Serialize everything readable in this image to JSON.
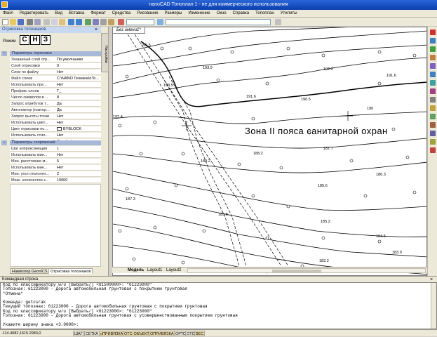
{
  "window": {
    "title": "nanoCAD Топоплан 1 - не для коммерческого использования"
  },
  "menu": [
    "Файл",
    "Редактировать",
    "Вид",
    "Вставка",
    "Формат",
    "Средства",
    "Рисование",
    "Размеры",
    "Изменение",
    "Окно",
    "Справка",
    "Топоплан",
    "Утилиты"
  ],
  "sidebar": {
    "title": "Отрисовка топознаков",
    "vtab": "Настройки",
    "mode_label": "Режим",
    "mode_buttons": [
      "С",
      "Н",
      "З"
    ],
    "section1": {
      "header": "Параметры отрисовки",
      "rows": [
        {
          "name": "Указанный слой отр...",
          "value": "По умолчанию"
        },
        {
          "name": "Слой отрисовки",
          "value": "0"
        },
        {
          "name": "Слои по файлу",
          "value": "Нет"
        },
        {
          "name": "Файл слоев",
          "value": "C:\\NANO Геоника\\nTo..."
        },
        {
          "name": "Использовать пре...",
          "value": "Нет"
        },
        {
          "name": "Префикс слоев",
          "value": "T_"
        },
        {
          "name": "Число символов в ...",
          "value": "8"
        },
        {
          "name": "Запрос атрибутов т...",
          "value": "Да"
        },
        {
          "name": "Автоповтор (повтор...",
          "value": "Да"
        },
        {
          "name": "Запрос высоты точки",
          "value": "Нет"
        },
        {
          "name": "Использовать цвет...",
          "value": "Нет"
        },
        {
          "name": "Цвет отрисовки по ...",
          "value": "BYBLOCK"
        },
        {
          "name": "Использовать стил...",
          "value": "Нет"
        },
        {
          "name": "Стиль текста и ад...",
          "value": "Standard"
        }
      ]
    },
    "section2": {
      "header": "Параметры сопряжений",
      "rows": [
        {
          "name": "Шаг аппроксимации",
          "value": "1"
        },
        {
          "name": "Использовать мин...",
          "value": "Нет"
        },
        {
          "name": "Мин. расстояние м...",
          "value": "5"
        },
        {
          "name": "Использовать мин...",
          "value": "Нет"
        },
        {
          "name": "Мин. угол отклонен...",
          "value": "2"
        },
        {
          "name": "Макс. количество з...",
          "value": "10000"
        }
      ]
    },
    "tabs": [
      "Навигатор GeonICS",
      "Отрисовка топознаков"
    ]
  },
  "drawing": {
    "doc_tab": "Без имени1*",
    "zone_text": "Зона II пояса санитарной охран",
    "elevations": [
      "195.5",
      "193.5",
      "193.9",
      "192.2",
      "191.6",
      "191.6",
      "190.5",
      "190",
      "192.4",
      "188.2",
      "187.7",
      "189.2",
      "185.6",
      "186.3",
      "187.3",
      "185.8",
      "185.2",
      "184.5",
      "183.9",
      "183.2"
    ],
    "layout_tabs": [
      "Модель",
      "Layout1",
      "Layout2"
    ]
  },
  "command": {
    "header": "Командная строка",
    "lines": [
      "Код по классификатору w/u [Выбрать/] <61500000>: \"61223000\"",
      "Топознак: 61223000 - Дорога автомобильная грунтовая с покрытием грунтовая",
      "*Отмена*",
      "",
      "Команда: getcsrak",
      "Текущий топознак: 61223000 - Дорога автомобильная грунтовая с покрытием грунтовая",
      "Код по классификатору w/u [Выбрать/] <61223000>: \"61223000\"",
      "Топознак: 61223000 - Дорога автомобильная грунтовая с усовершенствованным покрытием грунтовая",
      "",
      "Укажите ширину знака <3.0000>:"
    ]
  },
  "status": {
    "coords": "-114.4082,1615.2983,0",
    "buttons": [
      "ШАГ",
      "СЕТКА",
      "оПРИВЯЗКА",
      "ОТС-ОБЪЕКТ",
      "ОПРИВЯЗКА",
      "ОРТО",
      "ОТС",
      "ВЕС"
    ]
  }
}
